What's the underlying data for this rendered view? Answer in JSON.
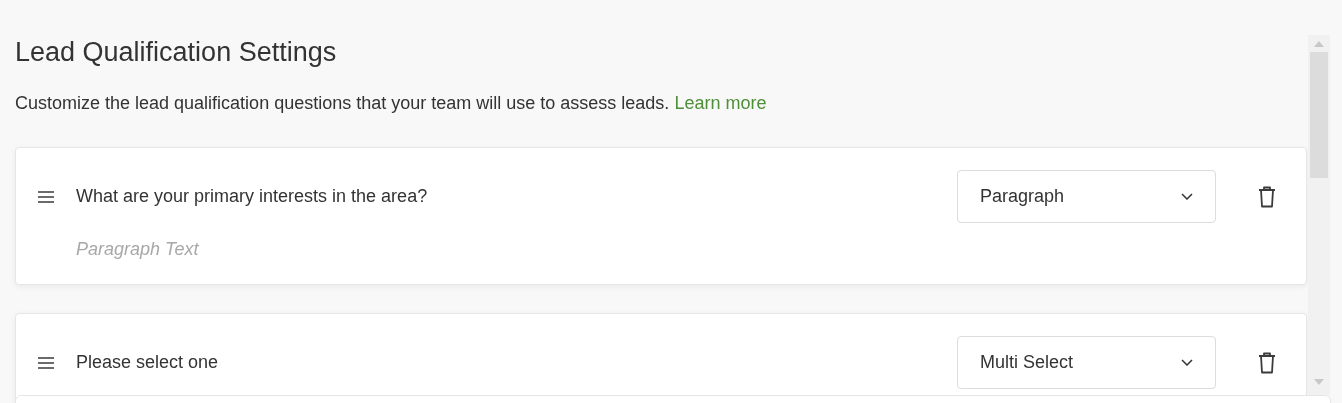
{
  "page": {
    "title": "Lead Qualification Settings",
    "description": "Customize the lead qualification questions that your team will use to assess leads.",
    "link": "Learn more"
  },
  "questions": [
    {
      "question": "What are your primary interests in the area?",
      "type": "Paragraph",
      "placeholder": "Paragraph Text"
    },
    {
      "question": "Please select one",
      "type": "Multi Select"
    }
  ]
}
